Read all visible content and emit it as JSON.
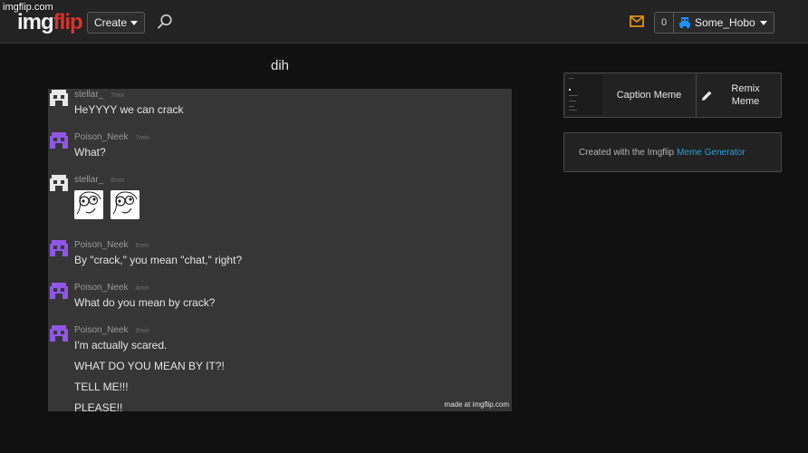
{
  "watermark": "imgflip.com",
  "header": {
    "logo_part1": "img",
    "logo_part2": "flip",
    "create_label": "Create",
    "notif_count": "0",
    "username": "Some_Hobo"
  },
  "icons": {
    "search": "search-icon",
    "mail": "mail-icon",
    "user": "user-icon",
    "pencil": "pencil-icon"
  },
  "colors": {
    "brand_red": "#d9322e",
    "mail_orange": "#f39c12",
    "user_blue": "#1e90ff",
    "link_blue": "#2aa0d8",
    "avatar_purple": "#8f57e6",
    "avatar_white": "#e8e8e8"
  },
  "meme": {
    "title": "dih",
    "made_at": "made at imgflip.com",
    "messages": [
      {
        "user": "stellar_",
        "time": "7min",
        "avatar": "white",
        "lines": [
          "HeYYYY we can crack"
        ]
      },
      {
        "user": "Poison_Neek",
        "time": "7min",
        "avatar": "purple",
        "lines": [
          "What?"
        ]
      },
      {
        "user": "stellar_",
        "time": "6min",
        "avatar": "white",
        "lines": []
      },
      {
        "user": "Poison_Neek",
        "time": "6min",
        "avatar": "purple",
        "lines": [
          "By \"crack,\" you mean \"chat,\" right?"
        ]
      },
      {
        "user": "Poison_Neek",
        "time": "4min",
        "avatar": "purple",
        "lines": [
          "What do you mean by crack?"
        ]
      },
      {
        "user": "Poison_Neek",
        "time": "3min",
        "avatar": "purple",
        "lines": [
          "I'm actually scared.",
          "WHAT DO YOU MEAN BY IT?!",
          "TELL ME!!!",
          "PLEASE!!"
        ]
      }
    ]
  },
  "sidebar": {
    "caption_label": "Caption Meme",
    "remix_line1": "Remix",
    "remix_line2": "Meme",
    "created_text": "Created with the Imgflip",
    "created_link": "Meme Generator"
  }
}
